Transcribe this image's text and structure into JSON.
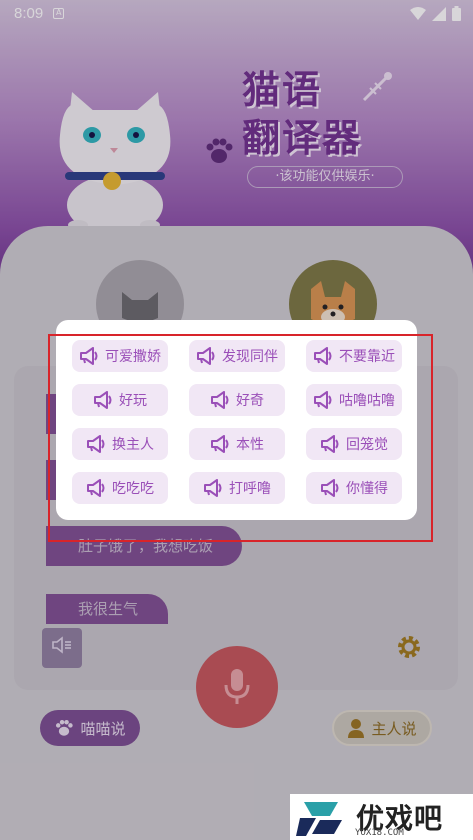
{
  "status_bar": {
    "time": "8:09",
    "notification_icon": "A"
  },
  "header": {
    "title_line1": "猫语",
    "title_line2": "翻译器",
    "disclaimer": "·该功能仅供娱乐·"
  },
  "chat": {
    "bubbles": [
      {
        "text": "肚子饿了，我想吃饭"
      },
      {
        "text": "我很生气"
      }
    ]
  },
  "modes": {
    "cat_label": "喵喵说",
    "owner_label": "主人说"
  },
  "phrase_dialog": {
    "phrases": [
      "可爱撒娇",
      "发现同伴",
      "不要靠近",
      "好玩",
      "好奇",
      "咕噜咕噜",
      "换主人",
      "本性",
      "回笼觉",
      "吃吃吃",
      "打呼噜",
      "你懂得"
    ]
  },
  "watermark": {
    "brand": "优戏吧",
    "domain": "YOX18.COM"
  },
  "colors": {
    "accent": "#9a4fb8",
    "chip_bg": "#f1e7f5",
    "highlight_border": "#d8242a"
  }
}
